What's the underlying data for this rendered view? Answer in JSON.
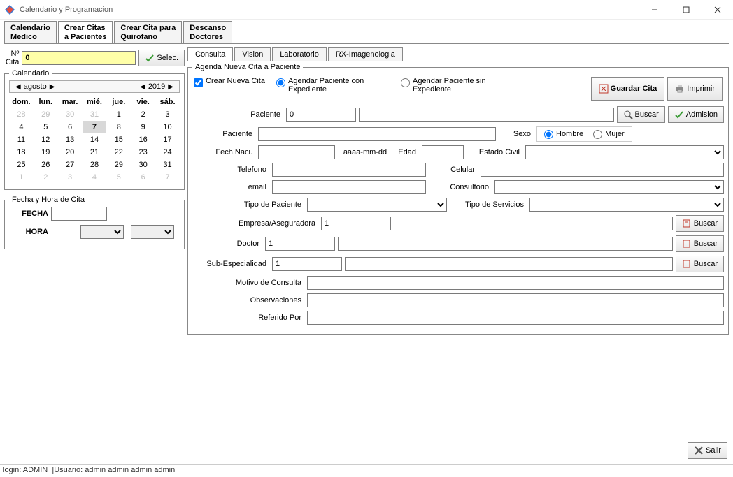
{
  "window": {
    "title": "Calendario y Programacion"
  },
  "mainTabs": [
    {
      "l1": "Calendario",
      "l2": "Medico"
    },
    {
      "l1": "Crear Citas",
      "l2": "a Pacientes"
    },
    {
      "l1": "Crear Cita para",
      "l2": "Quirofano"
    },
    {
      "l1": "Descanso",
      "l2": "Doctores"
    }
  ],
  "numCita": {
    "label": "Nº Cita",
    "value": "0",
    "selectBtn": "Selec."
  },
  "calendar": {
    "legend": "Calendario",
    "month": "agosto",
    "year": "2019",
    "dow": [
      "dom.",
      "lun.",
      "mar.",
      "mié.",
      "jue.",
      "vie.",
      "sáb."
    ],
    "weeks": [
      [
        {
          "d": "28",
          "dim": true
        },
        {
          "d": "29",
          "dim": true
        },
        {
          "d": "30",
          "dim": true
        },
        {
          "d": "31",
          "dim": true
        },
        {
          "d": "1"
        },
        {
          "d": "2"
        },
        {
          "d": "3"
        }
      ],
      [
        {
          "d": "4"
        },
        {
          "d": "5"
        },
        {
          "d": "6"
        },
        {
          "d": "7",
          "sel": true
        },
        {
          "d": "8"
        },
        {
          "d": "9"
        },
        {
          "d": "10"
        }
      ],
      [
        {
          "d": "11"
        },
        {
          "d": "12"
        },
        {
          "d": "13"
        },
        {
          "d": "14"
        },
        {
          "d": "15"
        },
        {
          "d": "16"
        },
        {
          "d": "17"
        }
      ],
      [
        {
          "d": "18"
        },
        {
          "d": "19"
        },
        {
          "d": "20"
        },
        {
          "d": "21"
        },
        {
          "d": "22"
        },
        {
          "d": "23"
        },
        {
          "d": "24"
        }
      ],
      [
        {
          "d": "25"
        },
        {
          "d": "26"
        },
        {
          "d": "27"
        },
        {
          "d": "28"
        },
        {
          "d": "29"
        },
        {
          "d": "30"
        },
        {
          "d": "31"
        }
      ],
      [
        {
          "d": "1",
          "dim": true
        },
        {
          "d": "2",
          "dim": true
        },
        {
          "d": "3",
          "dim": true
        },
        {
          "d": "4",
          "dim": true
        },
        {
          "d": "5",
          "dim": true
        },
        {
          "d": "6",
          "dim": true
        },
        {
          "d": "7",
          "dim": true
        }
      ]
    ]
  },
  "fechaHora": {
    "legend": "Fecha y Hora de Cita",
    "fechaLbl": "FECHA",
    "horaLbl": "HORA"
  },
  "subTabs": [
    "Consulta",
    "Vision",
    "Laboratorio",
    "RX-Imagenologia"
  ],
  "agenda": {
    "legend": "Agenda Nueva Cita a Paciente",
    "opt1": "Crear Nueva Cita",
    "opt2": "Agendar Paciente con Expediente",
    "opt3": "Agendar Paciente sin Expediente",
    "guardarBtn": "Guardar Cita",
    "imprimirBtn": "Imprimir",
    "buscarBtn": "Buscar",
    "admisionBtn": "Admision",
    "labels": {
      "paciente": "Paciente",
      "paciente2": "Paciente",
      "sexo": "Sexo",
      "hombre": "Hombre",
      "mujer": "Mujer",
      "fechNaci": "Fech.Naci.",
      "fmt": "aaaa-mm-dd",
      "edad": "Edad",
      "estadoCivil": "Estado Civil",
      "telefono": "Telefono",
      "celular": "Celular",
      "email": "email",
      "consultorio": "Consultorio",
      "tipoPaciente": "Tipo de Paciente",
      "tipoServicios": "Tipo de Servicios",
      "empresa": "Empresa/Aseguradora",
      "doctor": "Doctor",
      "subEsp": "Sub-Especialidad",
      "motivo": "Motivo de Consulta",
      "observ": "Observaciones",
      "referido": "Referido Por"
    },
    "values": {
      "pacienteId": "0",
      "empresaId": "1",
      "doctorId": "1",
      "subEspId": "1"
    }
  },
  "exitBtn": "Salir",
  "status": {
    "login": "login: ADMIN",
    "usuario": "Usuario: admin admin admin admin"
  }
}
